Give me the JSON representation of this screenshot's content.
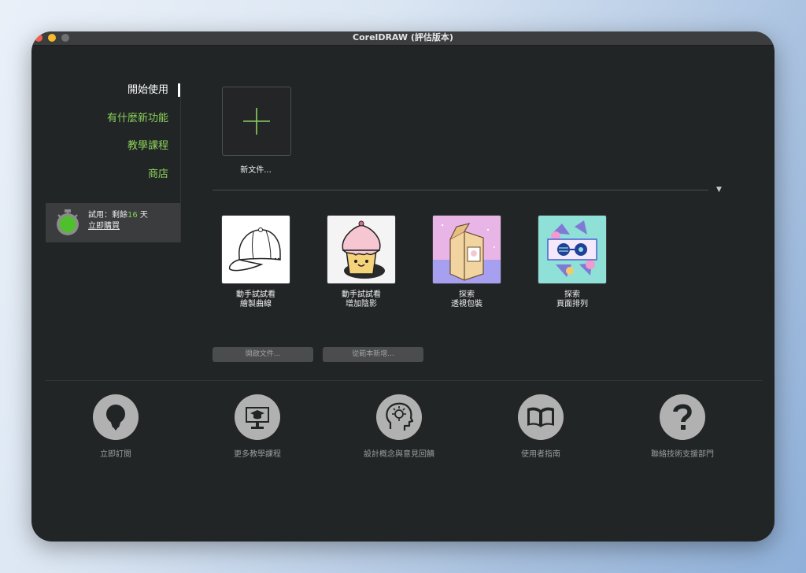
{
  "window": {
    "title": "CorelDRAW (評估版本)"
  },
  "nav": {
    "items": [
      {
        "label": "開始使用",
        "active": true
      },
      {
        "label": "有什麼新功能",
        "active": false
      },
      {
        "label": "教學課程",
        "active": false
      },
      {
        "label": "商店",
        "active": false
      }
    ]
  },
  "trial": {
    "prefix": "試用：剩餘",
    "days": "16",
    "suffix": " 天",
    "buy_label": "立即購買"
  },
  "new_document": {
    "label": "新文件..."
  },
  "templates": [
    {
      "line1": "動手試試看",
      "line2": "繪製曲線",
      "icon": "cap-icon"
    },
    {
      "line1": "動手試試看",
      "line2": "增加陰影",
      "icon": "cupcake-icon"
    },
    {
      "line1": "探索",
      "line2": "透視包裝",
      "icon": "milk-carton-icon"
    },
    {
      "line1": "探索",
      "line2": "頁面排列",
      "icon": "sunglasses-icon"
    }
  ],
  "actions": {
    "open_label": "開啟文件...",
    "from_template_label": "從範本新增..."
  },
  "resources": [
    {
      "label": "立即訂閱",
      "icon": "lightbulb-icon"
    },
    {
      "label": "更多教學課程",
      "icon": "graduation-monitor-icon"
    },
    {
      "label": "設計概念與意見回饋",
      "icon": "brain-idea-icon"
    },
    {
      "label": "使用者指南",
      "icon": "book-icon"
    },
    {
      "label": "聯絡技術支援部門",
      "icon": "question-icon"
    }
  ],
  "colors": {
    "accent_green": "#8bd05a",
    "window_bg": "#222526"
  }
}
